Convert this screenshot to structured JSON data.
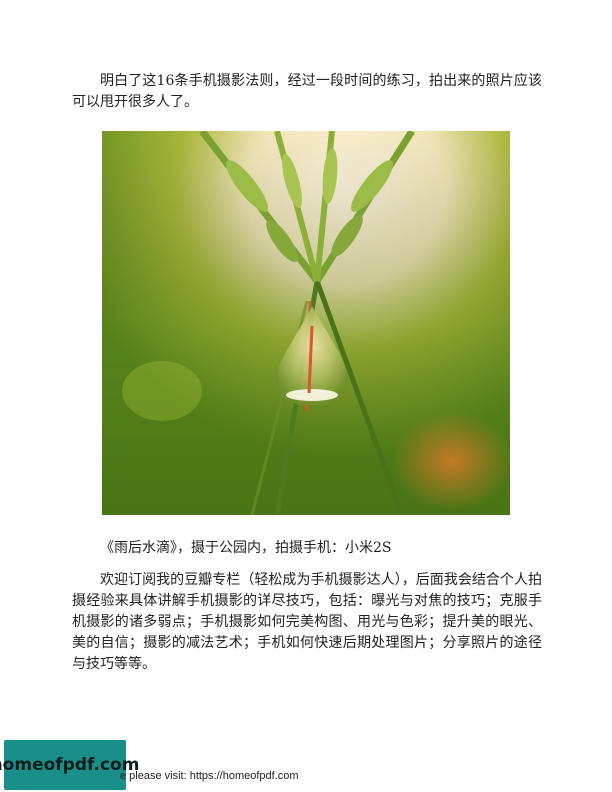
{
  "paragraph_1": "明白了这16条手机摄影法则，经过一段时间的练习，拍出来的照片应该可以甩开很多人了。",
  "photo_caption": "《雨后水滴》，摄于公园内，拍摄手机：小米2S",
  "paragraph_2": "欢迎订阅我的豆瓣专栏（轻松成为手机摄影达人），后面我会结合个人拍摄经验来具体讲解手机摄影的详尽技巧，包括：曝光与对焦的技巧；克服手机摄影的诸多弱点；手机摄影如何完美构图、用光与色彩；提升美的眼光、美的自信；摄影的减法艺术；手机如何快速后期处理图片；分享照片的途径与技巧等等。",
  "watermark_logo": "homeofpdf.com",
  "footer_text": "e please visit: https://homeofpdf.com",
  "colors": {
    "logo_background": "#1a8f8a",
    "text": "#222222"
  }
}
